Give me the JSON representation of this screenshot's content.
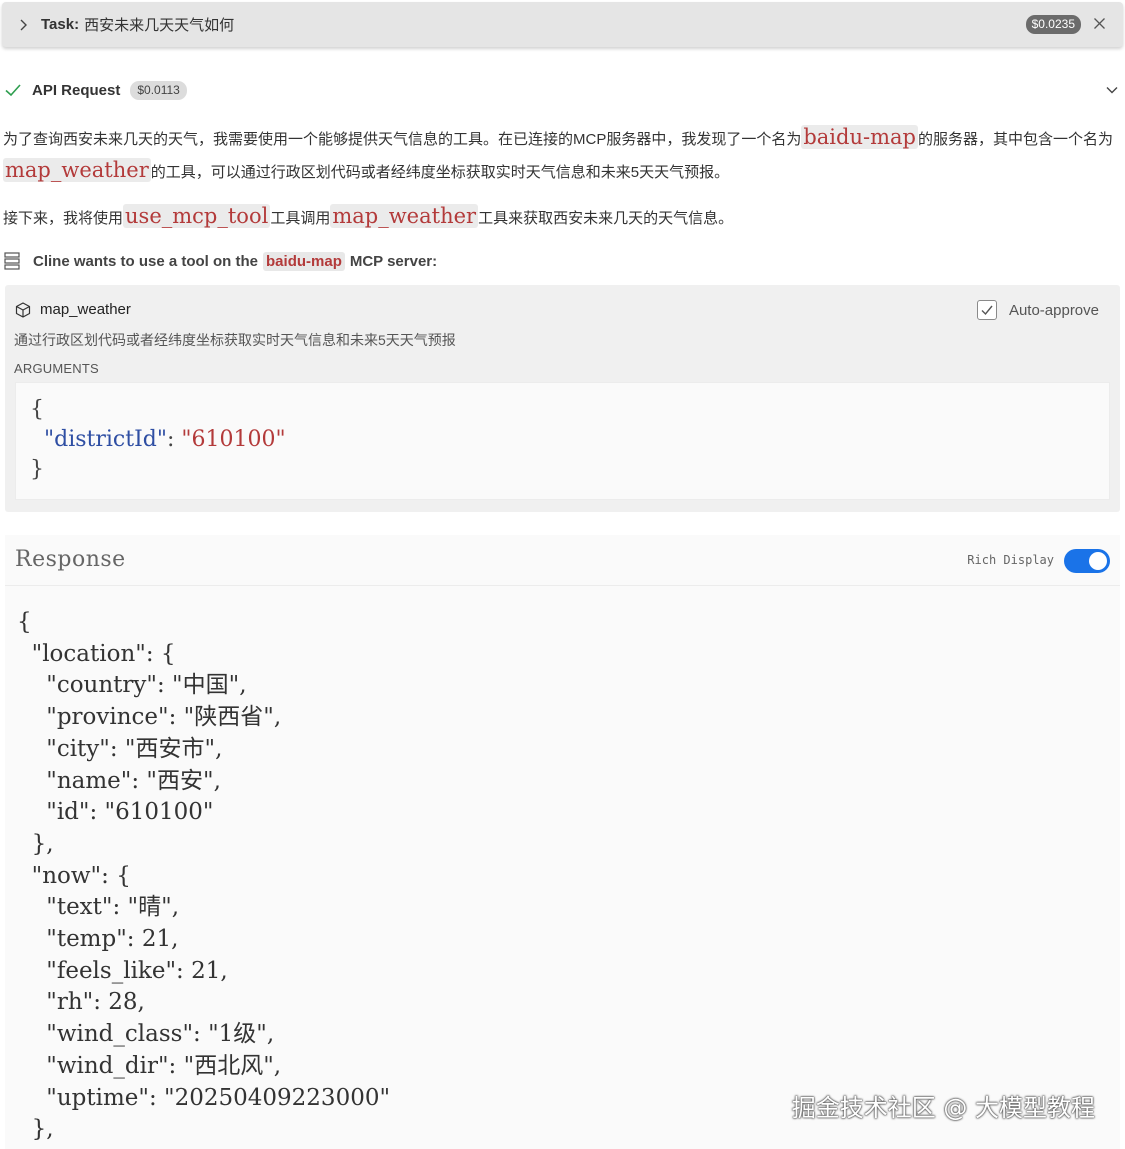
{
  "task": {
    "label": "Task:",
    "text": "西安未来几天天气如何",
    "cost": "$0.0235"
  },
  "api_request": {
    "label": "API Request",
    "cost": "$0.0113"
  },
  "paragraph1": {
    "t1": "为了查询西安未来几天的天气，我需要使用一个能够提供天气信息的工具。在已连接的MCP服务器中，我发现了一个名为",
    "code1": "baidu-map",
    "t2": "的服务器，其中包含一个名为",
    "code2": "map_weather",
    "t3": "的工具，可以通过行政区划代码或者经纬度坐标获取实时天气信息和未来5天天气预报。"
  },
  "paragraph2": {
    "t1": "接下来，我将使用",
    "code1": "use_mcp_tool",
    "t2": "工具调用",
    "code2": "map_weather",
    "t3": "工具来获取西安未来几天的天气信息。"
  },
  "cline_request": {
    "prefix": "Cline wants to use a tool on the",
    "server": "baidu-map",
    "suffix": "MCP server:"
  },
  "tool": {
    "name": "map_weather",
    "description": "通过行政区划代码或者经纬度坐标获取实时天气信息和未来5天天气预报",
    "auto_approve_label": "Auto-approve",
    "auto_approve_checked": true,
    "arguments_label": "ARGUMENTS",
    "arguments": {
      "open": "{",
      "key": "\"districtId\"",
      "colon": ": ",
      "value": "\"610100\"",
      "close": "}"
    }
  },
  "response": {
    "title": "Response",
    "rich_display_label": "Rich Display",
    "rich_display_on": true,
    "lines": [
      "{",
      "  \"location\": {",
      "    \"country\": \"中国\",",
      "    \"province\": \"陕西省\",",
      "    \"city\": \"西安市\",",
      "    \"name\": \"西安\",",
      "    \"id\": \"610100\"",
      "  },",
      "  \"now\": {",
      "    \"text\": \"晴\",",
      "    \"temp\": 21,",
      "    \"feels_like\": 21,",
      "    \"rh\": 28,",
      "    \"wind_class\": \"1级\",",
      "    \"wind_dir\": \"西北风\",",
      "    \"uptime\": \"20250409223000\"",
      "  },"
    ]
  },
  "watermark": "掘金技术社区 @ 大模型教程",
  "colors": {
    "accent": "#1a73e8",
    "code_text": "#b33a3a",
    "json_key": "#2e4ea3",
    "check": "#2e9e4f"
  }
}
